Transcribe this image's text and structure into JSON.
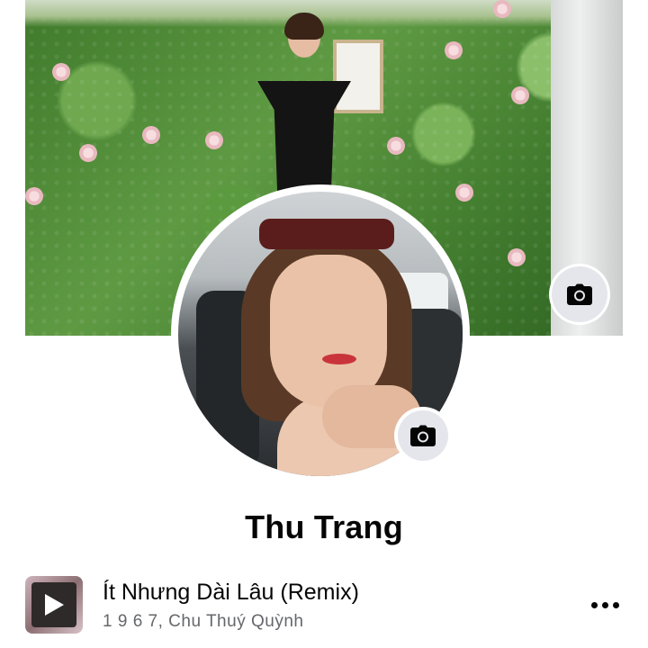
{
  "profile": {
    "name": "Thu Trang"
  },
  "cover": {
    "camera_icon": "camera-icon"
  },
  "avatar": {
    "camera_icon": "camera-icon"
  },
  "music": {
    "title": "Ít Nhưng Dài Lâu (Remix)",
    "artist": "1 9 6 7, Chu Thuý Quỳnh",
    "thumb_icon": "play-icon",
    "more_icon": "more-dots-icon"
  },
  "colors": {
    "text_primary": "#050505",
    "text_secondary": "#65676b",
    "button_bg": "#e4e6eb"
  }
}
